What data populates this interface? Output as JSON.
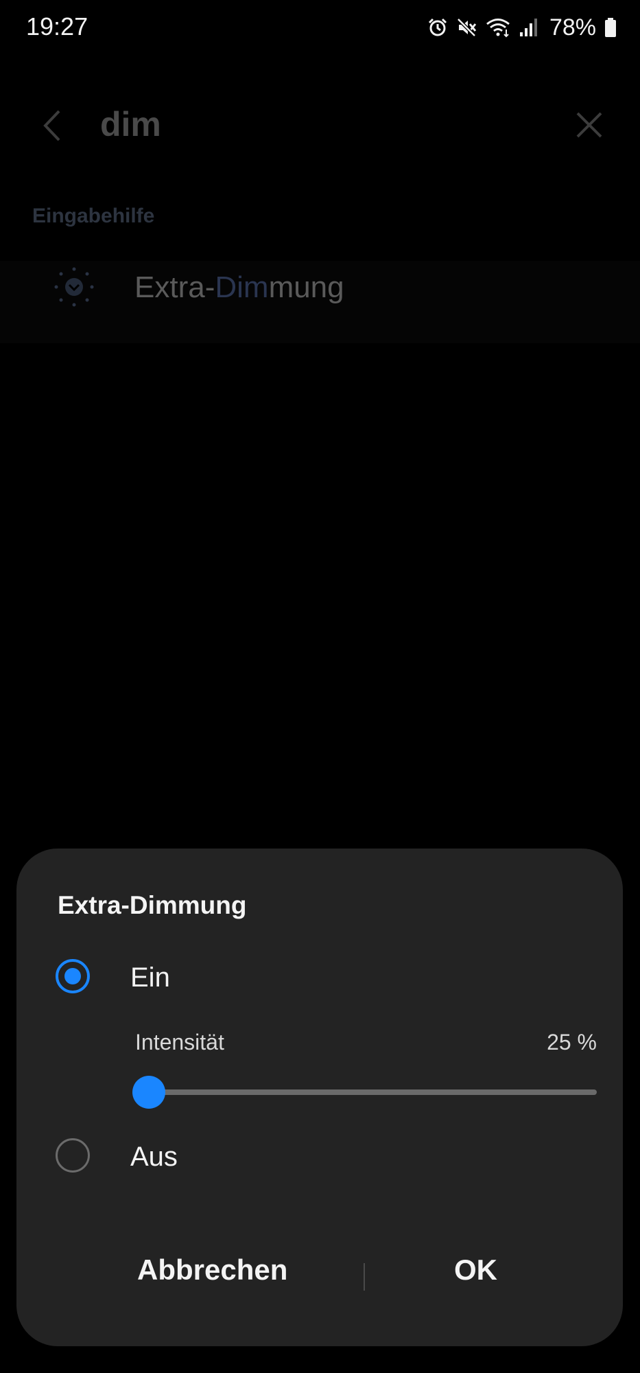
{
  "status_bar": {
    "time": "19:27",
    "battery": "78%",
    "icons": [
      "alarm-icon",
      "mute-icon",
      "wifi-icon",
      "signal-icon",
      "battery-icon"
    ]
  },
  "search": {
    "query": "dim",
    "icons": [
      "back-arrow-icon",
      "clear-icon"
    ]
  },
  "results": {
    "section": "Eingabehilfe",
    "items": [
      {
        "prefix": "Extra-",
        "highlight": "Dim",
        "suffix": "mung",
        "icon": "extra-dim-icon"
      }
    ]
  },
  "dialog": {
    "title": "Extra-Dimmung",
    "option_on": "Ein",
    "option_off": "Aus",
    "selected": "Ein",
    "intensity_label": "Intensität",
    "intensity_value": "25 %",
    "intensity_fraction": 0.03,
    "cancel_label": "Abbrechen",
    "ok_label": "OK"
  },
  "colors": {
    "accent": "#1a86ff",
    "dialog_background": "#232323",
    "background": "#000000"
  }
}
